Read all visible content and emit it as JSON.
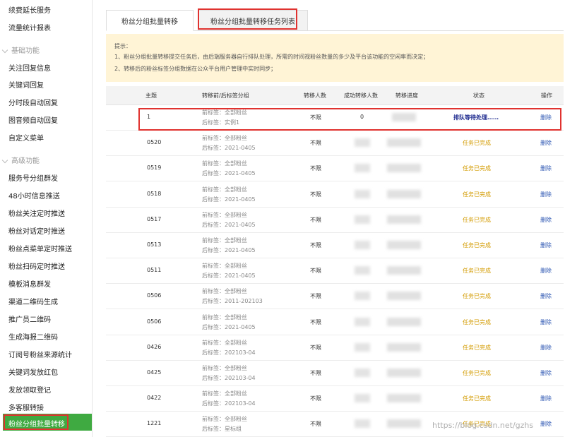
{
  "sidebar": {
    "items_top": [
      "续费延长服务",
      "流量统计报表"
    ],
    "section_basic": "基础功能",
    "basic_items": [
      "关注回复信息",
      "关键词回复",
      "分时段自动回复",
      "图音频自动回复",
      "自定义菜单"
    ],
    "section_advanced": "高级功能",
    "advanced_items": [
      "服务号分组群发",
      "48小时信息推送",
      "粉丝关注定时推送",
      "粉丝对话定时推送",
      "粉丝点菜单定时推送",
      "粉丝扫码定时推送",
      "模板消息群发",
      "渠道二维码生成",
      "推广员二维码",
      "生成海报二维码",
      "订阅号粉丝来源统计",
      "关键词发放红包",
      "发放领取登记",
      "多客服转接"
    ],
    "active_item": "粉丝分组批量转移"
  },
  "tabs": [
    "粉丝分组批量转移",
    "粉丝分组批量转移任务列表"
  ],
  "tip": {
    "title": "提示：",
    "line1": "1、粉丝分组批量转移提交任务后，由后端服务器自行排队处理，所需的时间视粉丝数量的多少及平台该功能的空闲率而决定；",
    "line2": "2、转移后的粉丝标签分组数据在公众平台用户管理中实时同步；"
  },
  "table": {
    "headers": [
      "主题",
      "转移前/后标签分组",
      "转移人数",
      "成功转移人数",
      "转移进度",
      "状态",
      "操作"
    ],
    "rows": [
      {
        "theme": "1",
        "tag_before": "前标签：全部粉丝",
        "tag_after": "后标签：实例1",
        "count": "不限",
        "success": "0",
        "status": "排队等待处理……",
        "op": "删除"
      },
      {
        "theme": "0520",
        "tag_before": "前标签：全部粉丝",
        "tag_after": "后标签：2021-0405",
        "count": "不限",
        "status": "任务已完成",
        "op": "删除"
      },
      {
        "theme": "0519",
        "tag_before": "前标签：全部粉丝",
        "tag_after": "后标签：2021-0405",
        "count": "不限",
        "status": "任务已完成",
        "op": "删除"
      },
      {
        "theme": "0518",
        "tag_before": "前标签：全部粉丝",
        "tag_after": "后标签：2021-0405",
        "count": "不限",
        "status": "任务已完成",
        "op": "删除"
      },
      {
        "theme": "0517",
        "tag_before": "前标签：全部粉丝",
        "tag_after": "后标签：2021-0405",
        "count": "不限",
        "status": "任务已完成",
        "op": "删除"
      },
      {
        "theme": "0513",
        "tag_before": "前标签：全部粉丝",
        "tag_after": "后标签：2021-0405",
        "count": "不限",
        "status": "任务已完成",
        "op": "删除"
      },
      {
        "theme": "0511",
        "tag_before": "前标签：全部粉丝",
        "tag_after": "后标签：2021-0405",
        "count": "不限",
        "status": "任务已完成",
        "op": "删除"
      },
      {
        "theme": "0506",
        "tag_before": "前标签：全部粉丝",
        "tag_after": "后标签：2011-202103",
        "count": "不限",
        "status": "任务已完成",
        "op": "删除"
      },
      {
        "theme": "0506",
        "tag_before": "前标签：全部粉丝",
        "tag_after": "后标签：2021-0405",
        "count": "不限",
        "status": "任务已完成",
        "op": "删除"
      },
      {
        "theme": "0426",
        "tag_before": "前标签：全部粉丝",
        "tag_after": "后标签：202103-04",
        "count": "不限",
        "status": "任务已完成",
        "op": "删除"
      },
      {
        "theme": "0425",
        "tag_before": "前标签：全部粉丝",
        "tag_after": "后标签：202103-04",
        "count": "不限",
        "status": "任务已完成",
        "op": "删除"
      },
      {
        "theme": "0422",
        "tag_before": "前标签：全部粉丝",
        "tag_after": "后标签：202103-04",
        "count": "不限",
        "status": "任务已完成",
        "op": "删除"
      },
      {
        "theme": "1221",
        "tag_before": "前标签：全部粉丝",
        "tag_after": "后标签：星标组",
        "count": "不限",
        "status": "任务已完成",
        "op": "删除"
      }
    ]
  },
  "watermark": "https://blog.csdn.net/gzhs",
  "colors": {
    "active_green": "#3faa41",
    "highlight_red": "#e0322f",
    "done_status": "#d39b00",
    "pending_status": "#1f2b8f",
    "link": "#2b55b2",
    "tip_bg": "#fff4d6"
  }
}
